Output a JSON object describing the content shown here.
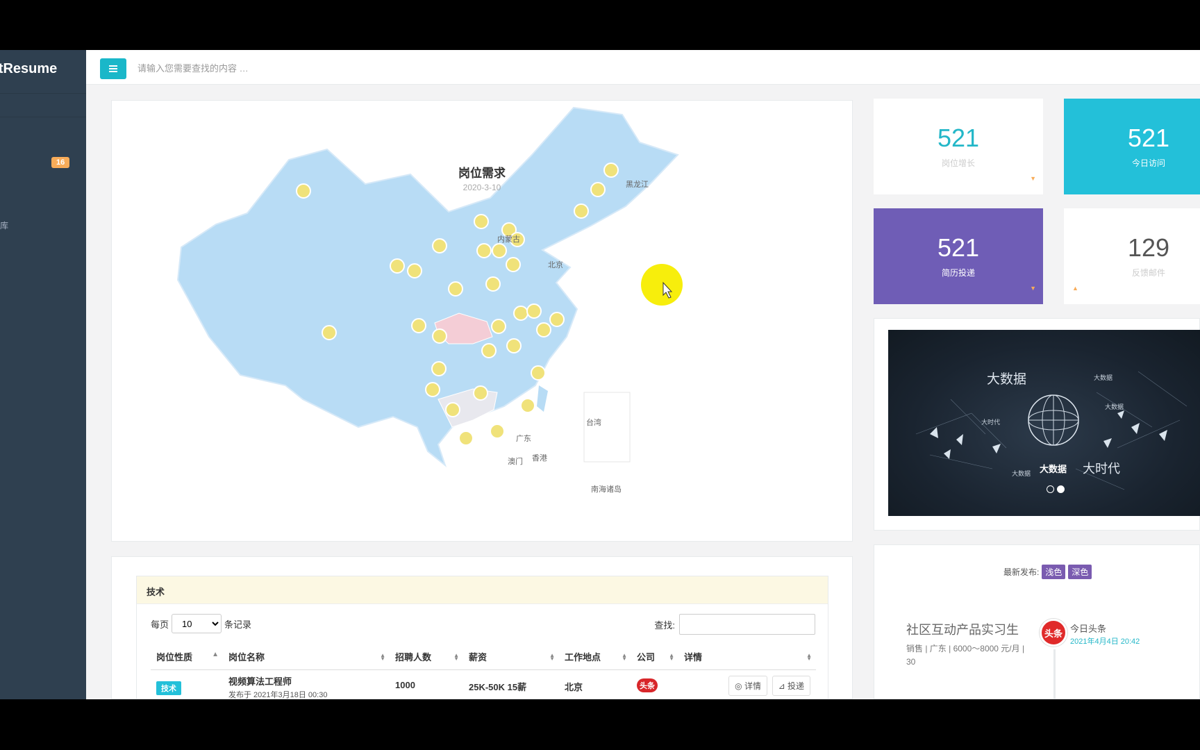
{
  "sidebar": {
    "brand": "rtResume",
    "badge": "16",
    "fragment": "库"
  },
  "topbar": {
    "search_placeholder": "请输入您需要查找的内容 …"
  },
  "map": {
    "title": "岗位需求",
    "date": "2020-3-10",
    "labels": {
      "heilongjiang": "黑龙江",
      "neimenggu": "内蒙古",
      "beijing": "北京",
      "guangdong": "广东",
      "macau": "澳门",
      "hongkong": "香港",
      "taiwan": "台湾",
      "south_sea": "南海诸岛"
    }
  },
  "stats": [
    {
      "value": "521",
      "label": "岗位增长",
      "arrow": "▼"
    },
    {
      "value": "521",
      "label": "今日访问",
      "arrow": ""
    },
    {
      "value": "521",
      "label": "简历投递",
      "arrow": "▼"
    },
    {
      "value": "129",
      "label": "反馈邮件",
      "arrow": "▲"
    }
  ],
  "banner": {
    "main_left": "大数据",
    "main_right": "大时代",
    "center": "大数据",
    "small1": "大时代",
    "small2": "大数据",
    "small3": "大数据",
    "small4": "大数据"
  },
  "news": {
    "heading": "最新发布:",
    "tag_light": "浅色",
    "tag_dark": "深色",
    "title": "社区互动产品实习生",
    "meta": "销售 | 广东 | 6000～8000 元/月 | 30",
    "logo_text": "头条",
    "source": "今日头条",
    "time": "2021年4月4日 20:42"
  },
  "table": {
    "card_title": "技术",
    "per_page_prefix": "每页",
    "per_page_value": "10",
    "per_page_suffix": "条记录",
    "search_label": "查找:",
    "headers": [
      "岗位性质",
      "岗位名称",
      "招聘人数",
      "薪资",
      "工作地点",
      "公司",
      "详情"
    ],
    "row": {
      "type": "技术",
      "name": "视频算法工程师",
      "posted": "发布于 2021年3月18日 00:30",
      "count": "1000",
      "salary": "25K-50K 15薪",
      "location": "北京",
      "company_logo": "头条",
      "detail_btn": "◎ 详情",
      "apply_btn": "⊿ 投递"
    }
  },
  "colors": {
    "accent": "#23c0d9",
    "purple": "#6f5db6",
    "sidebar": "#2f4050",
    "map_fill": "#b8dcf5",
    "marker": "#f0e27a"
  }
}
